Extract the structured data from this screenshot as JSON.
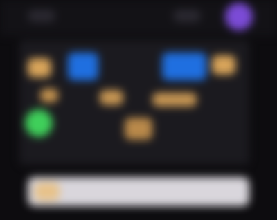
{
  "colors": {
    "background": "#0d0c0f",
    "board": "#1b1a1f",
    "accent_purple": "#7b4bd6",
    "accent_blue": "#1f6fe0",
    "accent_green": "#3fcf5a",
    "accent_tan": "#d8a45a",
    "bar": "#d9d6dc"
  },
  "icons": {
    "profile": "avatar-icon"
  }
}
